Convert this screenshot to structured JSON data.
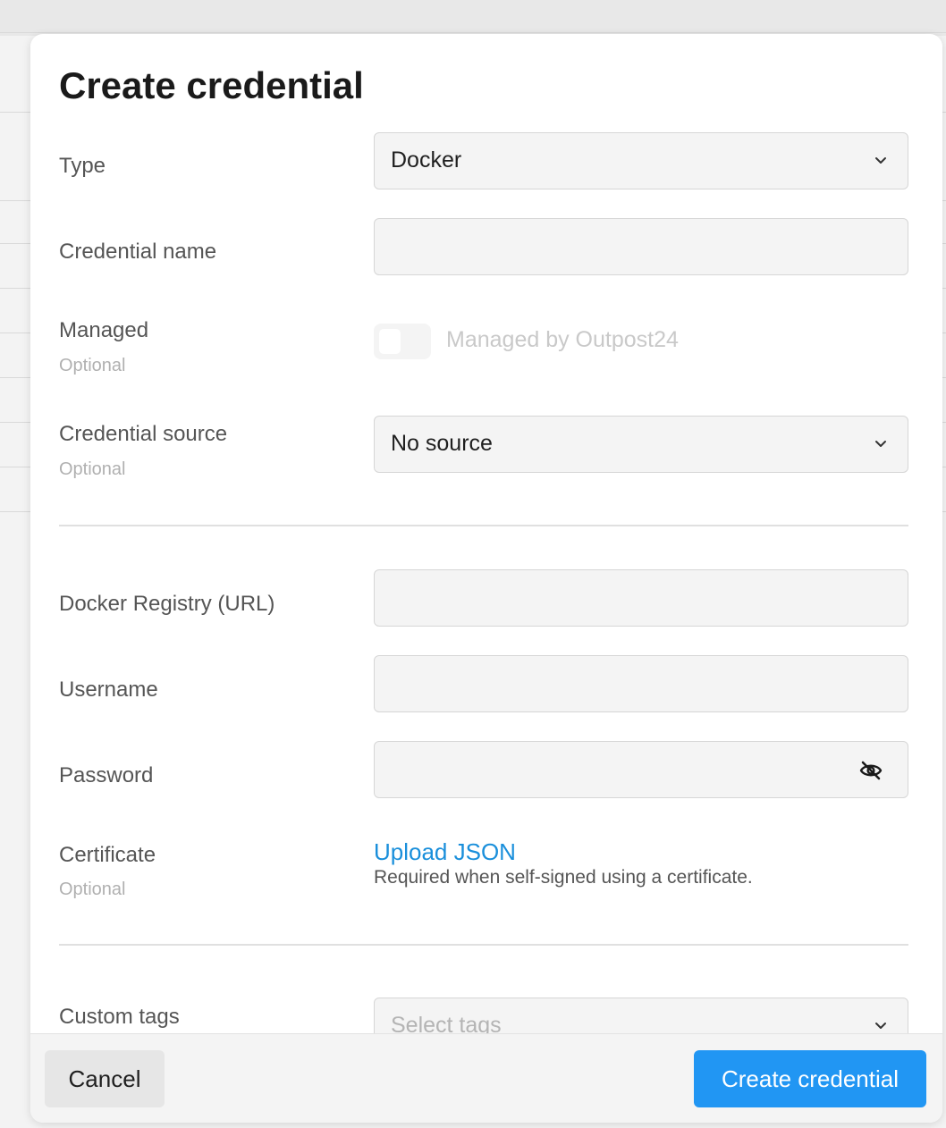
{
  "dialog": {
    "title": "Create credential"
  },
  "form": {
    "type": {
      "label": "Type",
      "value": "Docker"
    },
    "credential_name": {
      "label": "Credential name",
      "value": ""
    },
    "managed": {
      "label": "Managed",
      "hint": "Optional",
      "toggle_label": "Managed by Outpost24",
      "enabled": false
    },
    "credential_source": {
      "label": "Credential source",
      "hint": "Optional",
      "value": "No source"
    },
    "docker_registry": {
      "label": "Docker Registry (URL)",
      "value": ""
    },
    "username": {
      "label": "Username",
      "value": ""
    },
    "password": {
      "label": "Password",
      "value": ""
    },
    "certificate": {
      "label": "Certificate",
      "hint": "Optional",
      "upload_link": "Upload JSON",
      "helper": "Required when self-signed using a certificate."
    },
    "custom_tags": {
      "label": "Custom tags",
      "placeholder": "Select tags"
    }
  },
  "footer": {
    "cancel_label": "Cancel",
    "create_label": "Create credential"
  },
  "colors": {
    "primary": "#2196f3",
    "link": "#1a8fdb"
  },
  "icons": {
    "select_chevron": "chevron-down-icon",
    "password_toggle": "eye-off-icon"
  }
}
